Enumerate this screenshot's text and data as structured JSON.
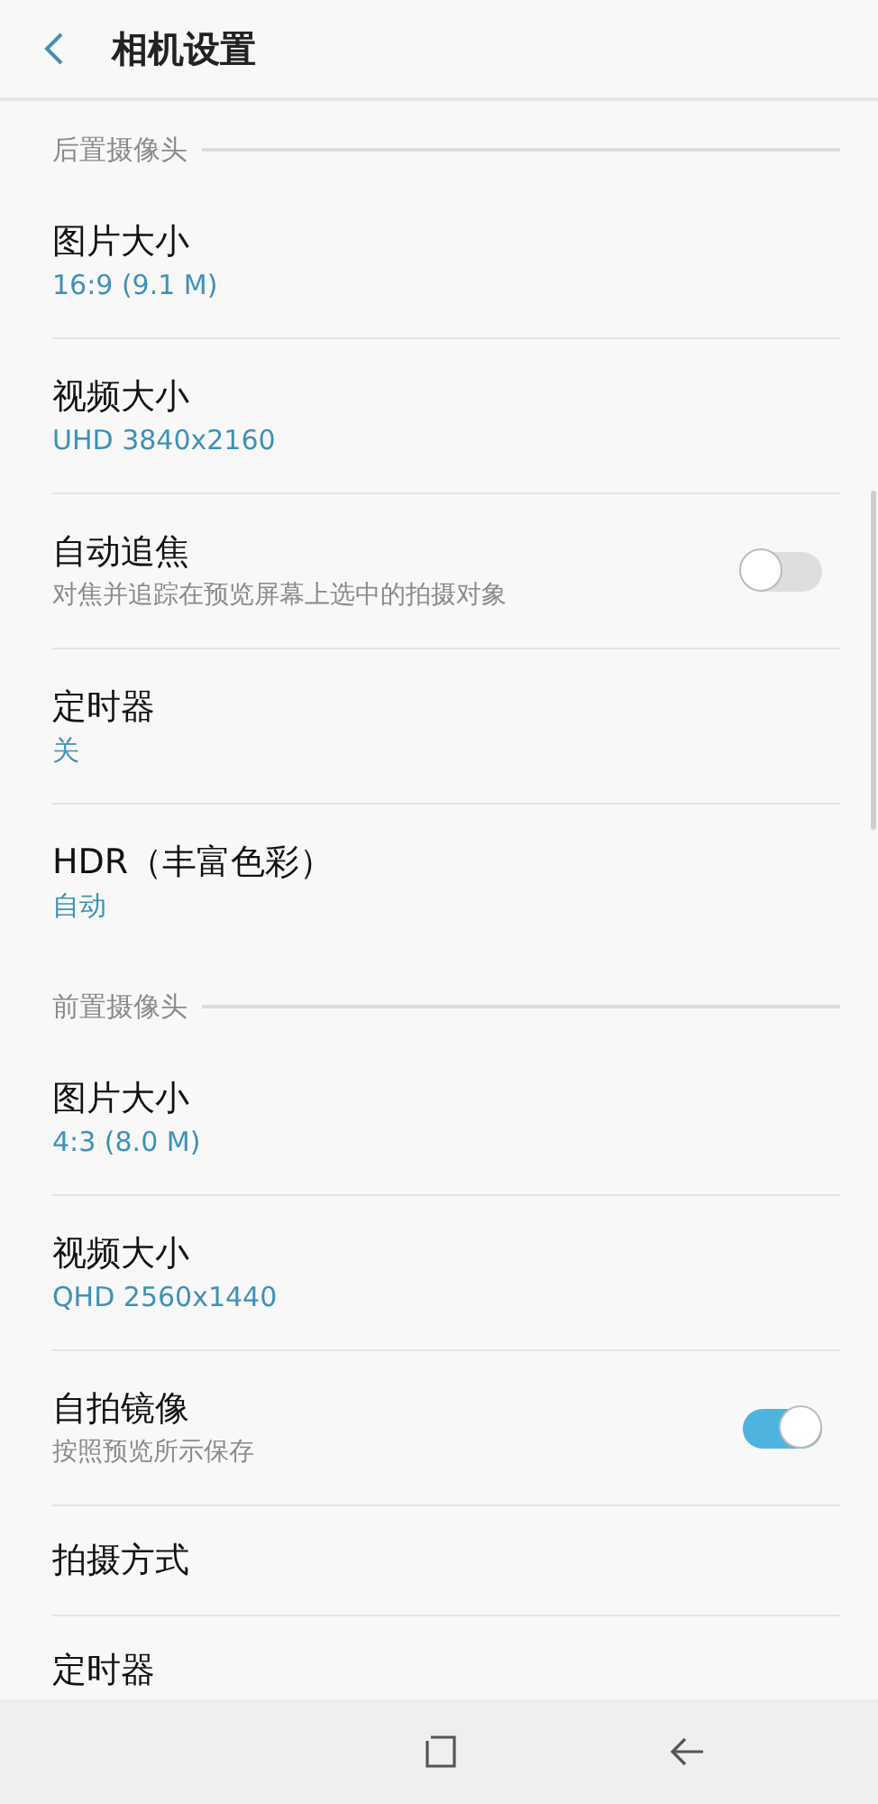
{
  "header": {
    "title": "相机设置"
  },
  "sections": [
    {
      "title": "后置摄像头",
      "items": [
        {
          "kind": "value",
          "title": "图片大小",
          "value": "16:9 (9.1 M)"
        },
        {
          "kind": "value",
          "title": "视频大小",
          "value": "UHD 3840x2160"
        },
        {
          "kind": "switch",
          "title": "自动追焦",
          "description": "对焦并追踪在预览屏幕上选中的拍摄对象",
          "on": false
        },
        {
          "kind": "value",
          "title": "定时器",
          "value": "关"
        },
        {
          "kind": "value",
          "title": "HDR（丰富色彩）",
          "value": "自动"
        }
      ]
    },
    {
      "title": "前置摄像头",
      "items": [
        {
          "kind": "value",
          "title": "图片大小",
          "value": "4:3 (8.0 M)"
        },
        {
          "kind": "value",
          "title": "视频大小",
          "value": "QHD 2560x1440"
        },
        {
          "kind": "switch",
          "title": "自拍镜像",
          "description": "按照预览所示保存",
          "on": true
        },
        {
          "kind": "plain",
          "title": "拍摄方式"
        },
        {
          "kind": "plain",
          "title": "定时器"
        }
      ]
    }
  ]
}
